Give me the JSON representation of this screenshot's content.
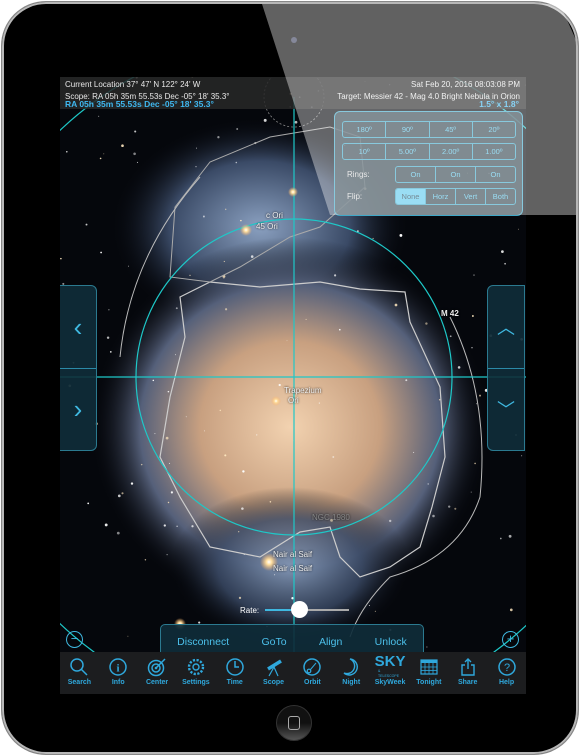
{
  "header": {
    "location": "Current Location  37° 47' N 122° 24' W",
    "datetime": "Sat Feb 20, 2016  08:03:08 PM",
    "scope": "Scope: RA 05h 35m 55.53s    Dec -05° 18' 35.3°",
    "target": "Target: Messier 42 - Mag 4.0 Bright Nebula in Orion",
    "ra_dec": "RA 05h 35m 55.53s Dec -05° 18' 35.3°",
    "fov": "1.5° x 1.8°"
  },
  "fov_panel": {
    "row1": [
      "180º",
      "90º",
      "45º",
      "20º"
    ],
    "row2": [
      "10º",
      "5.00º",
      "2.00º",
      "1.00º"
    ],
    "rings_label": "Rings:",
    "rings": [
      "On",
      "On",
      "On"
    ],
    "flip_label": "Flip:",
    "flip": [
      "None",
      "Horz",
      "Vert",
      "Both"
    ],
    "flip_selected": "None"
  },
  "sky_labels": {
    "c_ori": "c Ori",
    "ori45": "45 Ori",
    "m42": "M 42",
    "trapezium": "Trapezium",
    "ori": "Ori",
    "ngc1980": "NGC 1980",
    "nair1": "Nair al Saif",
    "nair2": "Nair al Saif"
  },
  "side_controls": {
    "left_up": "‹",
    "left_down": "›",
    "right_up": "︿",
    "right_down": "﹀",
    "zoom_out": "−",
    "zoom_in": "+"
  },
  "rate": {
    "label": "Rate:",
    "value_fraction": 0.4
  },
  "actions": [
    "Disconnect",
    "GoTo",
    "Align",
    "Unlock"
  ],
  "toolbar": [
    {
      "label": "Search",
      "icon": "search-icon"
    },
    {
      "label": "Info",
      "icon": "info-icon"
    },
    {
      "label": "Center",
      "icon": "target-icon"
    },
    {
      "label": "Settings",
      "icon": "gear-icon"
    },
    {
      "label": "Time",
      "icon": "clock-icon"
    },
    {
      "label": "Scope",
      "icon": "telescope-icon"
    },
    {
      "label": "Orbit",
      "icon": "orbit-icon"
    },
    {
      "label": "Night",
      "icon": "moon-icon"
    },
    {
      "label": "SkyWeek",
      "icon": "sky-telescope-logo-icon"
    },
    {
      "label": "Tonight",
      "icon": "calendar-icon"
    },
    {
      "label": "Share",
      "icon": "share-icon"
    },
    {
      "label": "Help",
      "icon": "help-icon"
    }
  ],
  "skyweek_logo": {
    "main": "SKY",
    "sub": "& TELESCOPE"
  },
  "colors": {
    "accent": "#3fb8e0",
    "ring": "#1ec8c8",
    "selected": "#5cc8ee"
  }
}
